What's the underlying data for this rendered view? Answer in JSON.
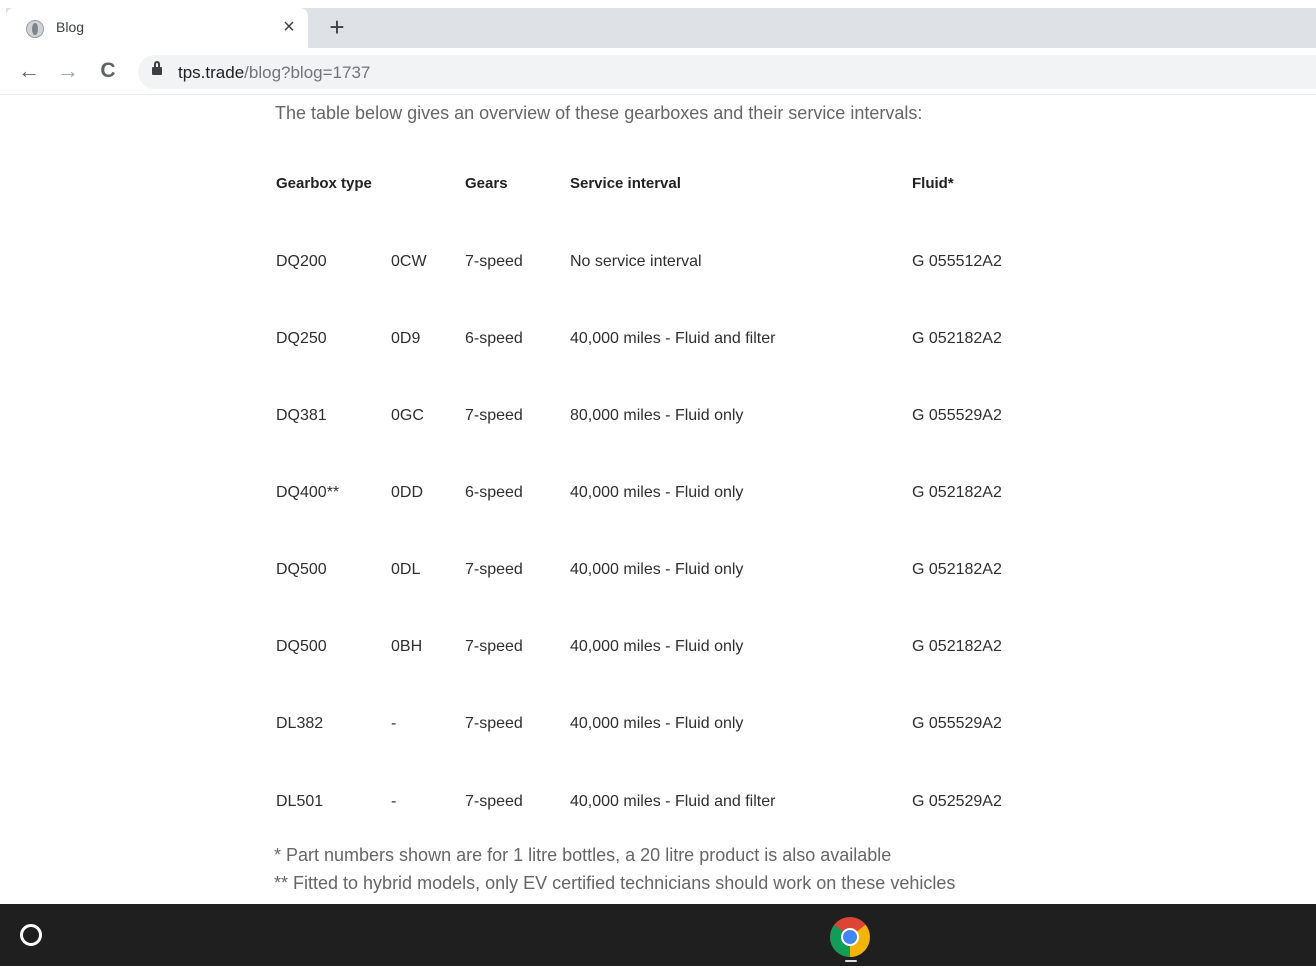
{
  "browser": {
    "tab_title": "Blog",
    "close_label": "×",
    "new_tab_label": "+",
    "back_label": "←",
    "forward_label": "→",
    "reload_label": "C",
    "url_host": "tps.trade",
    "url_path": "/blog?blog=1737"
  },
  "page": {
    "intro": "The table below gives an overview of these gearboxes and their service intervals:",
    "table": {
      "headers": [
        "Gearbox type",
        "Gears",
        "Service interval",
        "Fluid*"
      ],
      "rows": [
        [
          "DQ200",
          "0CW",
          "7-speed",
          "No service interval",
          "G 055512A2"
        ],
        [
          "DQ250",
          "0D9",
          "6-speed",
          "40,000 miles - Fluid and filter",
          "G 052182A2"
        ],
        [
          "DQ381",
          "0GC",
          "7-speed",
          "80,000 miles - Fluid only",
          "G 055529A2"
        ],
        [
          "DQ400**",
          "0DD",
          "6-speed",
          "40,000 miles - Fluid only",
          "G 052182A2"
        ],
        [
          "DQ500",
          "0DL",
          "7-speed",
          "40,000 miles - Fluid only",
          "G 052182A2"
        ],
        [
          "DQ500",
          "0BH",
          "7-speed",
          "40,000 miles - Fluid only",
          "G 052182A2"
        ],
        [
          "DL382",
          "-",
          "7-speed",
          "40,000 miles - Fluid only",
          "G 055529A2"
        ],
        [
          "DL501",
          "-",
          "7-speed",
          "40,000 miles - Fluid and filter",
          "G 052529A2"
        ]
      ]
    },
    "footnotes": [
      "* Part numbers shown are for 1 litre bottles, a 20 litre product is also available",
      "** Fitted to hybrid models, only EV certified technicians should work on these vehicles"
    ]
  },
  "taskbar": {
    "launcher_icon": "circle-icon",
    "app_icon": "chrome-icon"
  }
}
